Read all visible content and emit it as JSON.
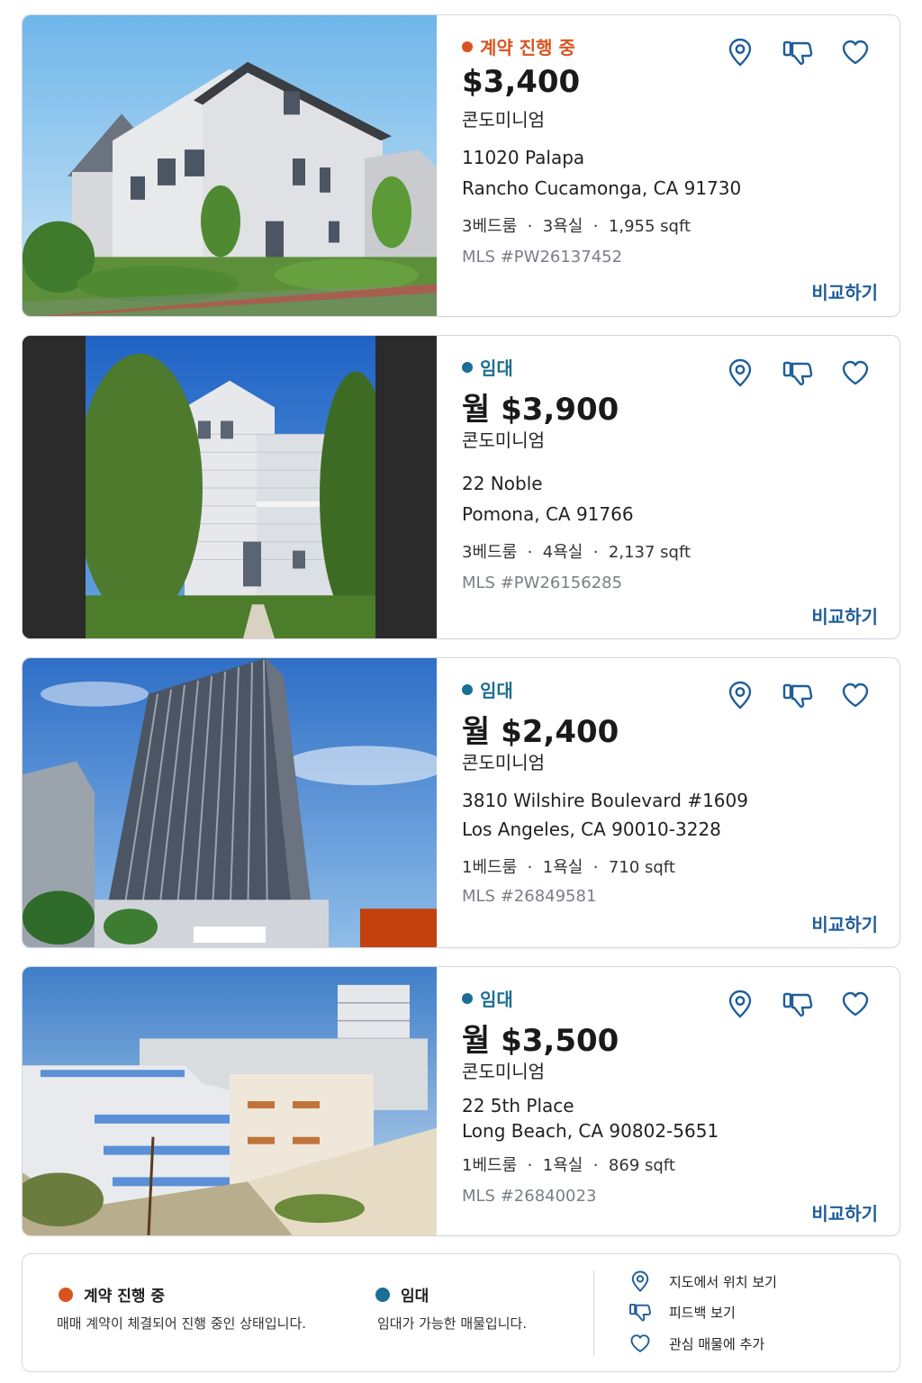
{
  "colors": {
    "pending": "#d9531e",
    "rent": "#1b6e94",
    "accent": "#1f5e9a",
    "mls": "#7a7e85"
  },
  "listings": [
    {
      "status": "계약 진행 중",
      "status_type": "pending",
      "price": "$3,400",
      "property_type": "콘도미니엄",
      "address_line1": "11020 Palapa",
      "address_line2": "Rancho Cucamonga, CA 91730",
      "specs": "3베드룸  ·  3욕실  ·  1,955 sqft",
      "mls": "MLS #PW26137452",
      "compare_label": "비교하기",
      "photo_desc": "townhouse"
    },
    {
      "status": "임대",
      "status_type": "rent",
      "price": "월 $3,900",
      "property_type": "콘도미니엄",
      "address_line1": "22 Noble",
      "address_line2": "Pomona, CA 91766",
      "specs": "3베드룸  ·  4욕실  ·  2,137 sqft",
      "mls": "MLS #PW26156285",
      "compare_label": "비교하기",
      "photo_desc": "house"
    },
    {
      "status": "임대",
      "status_type": "rent",
      "price": "월 $2,400",
      "property_type": "콘도미니엄",
      "address_line1": "3810 Wilshire Boulevard #1609",
      "address_line2": "Los Angeles, CA 90010-3228",
      "specs": "1베드룸  ·  1욕실  ·  710 sqft",
      "mls": "MLS #26849581",
      "compare_label": "비교하기",
      "photo_desc": "tower"
    },
    {
      "status": "임대",
      "status_type": "rent",
      "price": "월 $3,500",
      "property_type": "콘도미니엄",
      "address_line1": "22 5th Place",
      "address_line2": "Long Beach, CA 90802-5651",
      "specs": "1베드룸  ·  1욕실  ·  869 sqft",
      "mls": "MLS #26840023",
      "compare_label": "비교하기",
      "photo_desc": "beach-building"
    }
  ],
  "icons": [
    "map-pin-icon",
    "thumbs-down-icon",
    "heart-icon"
  ],
  "legend": {
    "pending_title": "계약 진행 중",
    "pending_desc": "매매 계약이 체결되어 진행 중인 상태입니다.",
    "rent_title": "임대",
    "rent_desc": "임대가 가능한 매물입니다.",
    "map_label": "지도에서 위치 보기",
    "feedback_label": "피드백 보기",
    "favorite_label": "관심 매물에 추가"
  }
}
